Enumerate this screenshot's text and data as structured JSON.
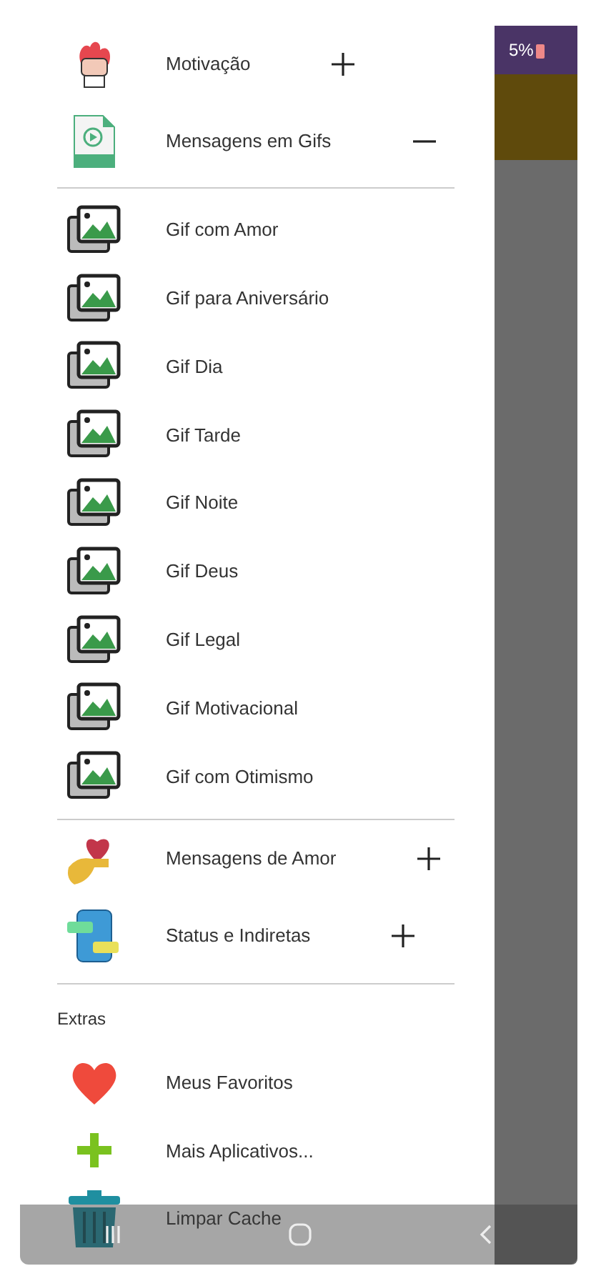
{
  "status_bar": {
    "battery": "5%"
  },
  "menu": {
    "top_categories": [
      {
        "label": "Motivação",
        "expanded": false
      },
      {
        "label": "Mensagens em Gifs",
        "expanded": true,
        "children": [
          {
            "label": "Gif com Amor"
          },
          {
            "label": "Gif para Aniversário"
          },
          {
            "label": "Gif Dia"
          },
          {
            "label": "Gif Tarde"
          },
          {
            "label": "Gif Noite"
          },
          {
            "label": "Gif Deus"
          },
          {
            "label": "Gif Legal"
          },
          {
            "label": "Gif Motivacional"
          },
          {
            "label": "Gif com Otimismo"
          }
        ]
      }
    ],
    "more_categories": [
      {
        "label": "Mensagens de Amor",
        "expanded": false
      },
      {
        "label": "Status e Indiretas",
        "expanded": false
      }
    ],
    "extras": {
      "heading": "Extras",
      "items": [
        {
          "label": "Meus Favoritos"
        },
        {
          "label": "Mais Aplicativos..."
        },
        {
          "label": "Limpar Cache"
        }
      ]
    }
  }
}
